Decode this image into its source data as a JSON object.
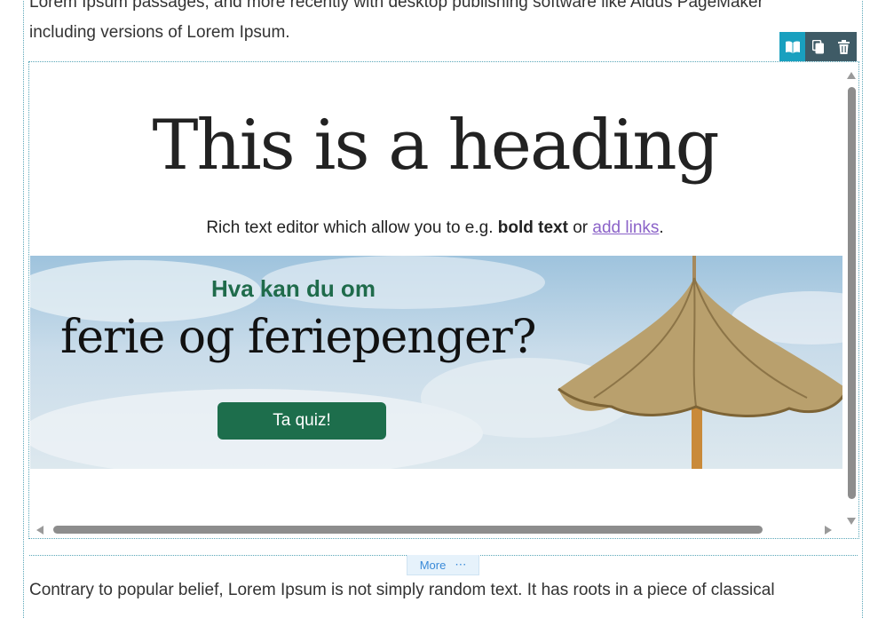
{
  "intro": {
    "line1": "Lorem Ipsum passages, and more recently with desktop publishing software like Aldus PageMaker",
    "line2": "including versions of Lorem Ipsum."
  },
  "toolbar": {
    "buttons": [
      {
        "icon": "book-open-icon",
        "active": true
      },
      {
        "icon": "copy-icon",
        "active": false
      },
      {
        "icon": "trash-icon",
        "active": false
      }
    ],
    "active_color": "#19a0bf",
    "bg_color": "#3f5b66"
  },
  "block": {
    "heading": "This is a heading",
    "rich_prefix": "Rich text editor which allow you to e.g. ",
    "rich_bold": "bold text",
    "rich_mid": " or ",
    "rich_link": "add links",
    "rich_suffix": ".",
    "banner": {
      "kicker": "Hva kan du om",
      "title": "ferie og feriepenger?",
      "cta": "Ta quiz!",
      "cta_color": "#1d6e4c"
    }
  },
  "more": {
    "label": "More",
    "dots": "⋯"
  },
  "body_text": "Contrary to popular belief, Lorem Ipsum is not simply random text. It has roots in a piece of classical"
}
